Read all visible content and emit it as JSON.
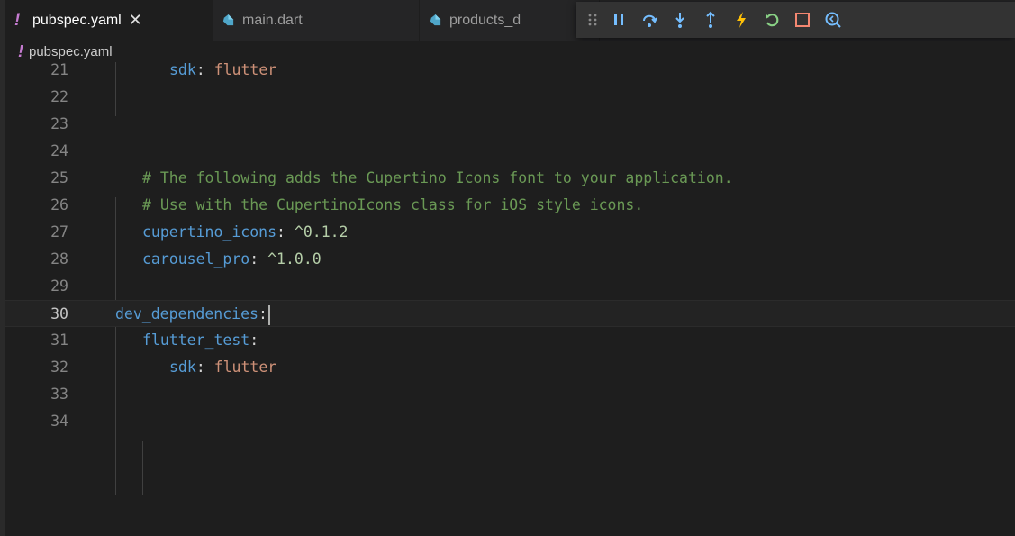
{
  "tabs": [
    {
      "label": "pubspec.yaml",
      "icon": "yaml-icon",
      "active": true
    },
    {
      "label": "main.dart",
      "icon": "dart-icon",
      "active": false
    },
    {
      "label": "products_d",
      "icon": "dart-icon",
      "active": false
    }
  ],
  "close_glyph": "✕",
  "breadcrumb": {
    "file": "pubspec.yaml"
  },
  "debug_toolbar": [
    "drag-handle-icon",
    "pause-icon",
    "step-over-icon",
    "step-into-icon",
    "step-out-icon",
    "hot-reload-icon",
    "restart-icon",
    "stop-icon",
    "flutter-inspector-icon"
  ],
  "editor": {
    "lines": [
      {
        "n": "21"
      },
      {
        "n": "22"
      },
      {
        "n": "23"
      },
      {
        "n": "24"
      },
      {
        "n": "25"
      },
      {
        "n": "26"
      },
      {
        "n": "27"
      },
      {
        "n": "28"
      },
      {
        "n": "29"
      },
      {
        "n": "30"
      },
      {
        "n": "31"
      },
      {
        "n": "32"
      },
      {
        "n": "33"
      },
      {
        "n": "34"
      }
    ],
    "l21": {
      "key": "sdk",
      "colon": ":",
      "value": "flutter"
    },
    "l25": {
      "comment": "# The following adds the Cupertino Icons font to your application."
    },
    "l26": {
      "comment": "# Use with the CupertinoIcons class for iOS style icons."
    },
    "l27": {
      "key": "cupertino_icons",
      "colon": ":",
      "value": "^0.1.2"
    },
    "l28": {
      "key": "carousel_pro",
      "colon": ":",
      "value": "^1.0.0"
    },
    "l30": {
      "key": "dev_dependencies",
      "colon": ":"
    },
    "l31": {
      "key": "flutter_test",
      "colon": ":"
    },
    "l32": {
      "key": "sdk",
      "colon": ":",
      "value": "flutter"
    }
  },
  "colors": {
    "keyword": "#569cd6",
    "string": "#ce9178",
    "number": "#b5cea8",
    "comment": "#6a9955",
    "bang": "#c57bd0"
  }
}
